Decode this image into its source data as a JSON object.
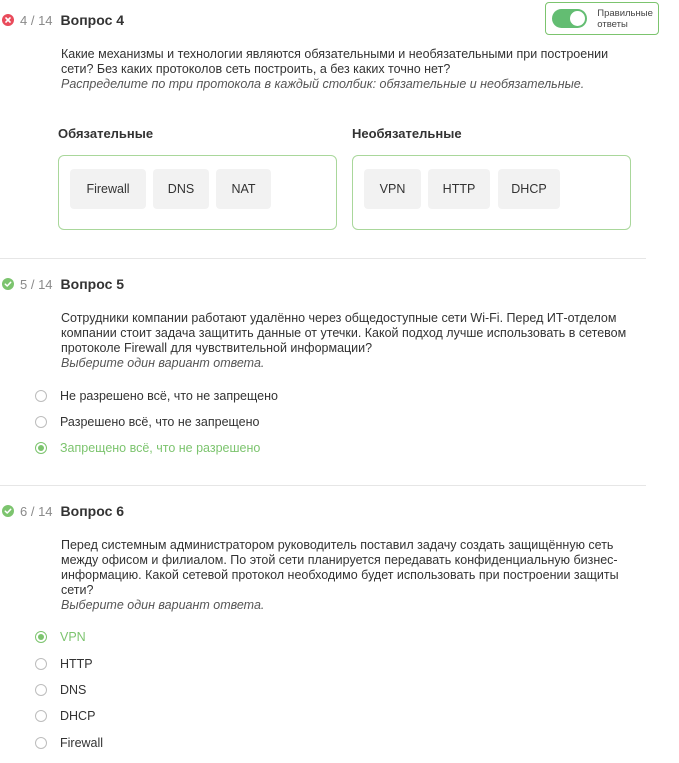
{
  "toggle": {
    "label": "Правильные ответы",
    "on": true
  },
  "q4": {
    "status": "incorrect",
    "counter": "4 / 14",
    "title": "Вопрос 4",
    "text": "Какие механизмы и технологии являются обязательными и необязательными при построении сети? Без каких протоколов сеть построить, а без каких точно нет?",
    "hint": "Распределите по три протокола в каждый столбик: обязательные и необязательные.",
    "col1": {
      "heading": "Обязательные",
      "items": [
        "Firewall",
        "DNS",
        "NAT"
      ]
    },
    "col2": {
      "heading": "Необязательные",
      "items": [
        "VPN",
        "HTTP",
        "DHCP"
      ]
    }
  },
  "q5": {
    "status": "correct",
    "counter": "5 / 14",
    "title": "Вопрос 5",
    "text": "Сотрудники компании работают удалённо через общедоступные сети Wi-Fi. Перед ИТ-отделом компании стоит задача защитить данные от утечки. Какой подход лучше использовать в сетевом протоколе Firewall для чувствительной информации?",
    "hint": "Выберите один вариант ответа.",
    "options": [
      "Не разрешено всё, что не запрещено",
      "Разрешено всё, что не запрещено",
      "Запрещено всё, что не разрешено"
    ],
    "selected": 2
  },
  "q6": {
    "status": "correct",
    "counter": "6 / 14",
    "title": "Вопрос 6",
    "text": "Перед системным администратором руководитель поставил задачу создать защищённую сеть между офисом и филиалом. По этой сети планируется передавать конфиденциальную бизнес-информацию. Какой сетевой протокол необходимо будет использовать при построении защиты сети?",
    "hint": "Выберите один вариант ответа.",
    "options": [
      "VPN",
      "HTTP",
      "DNS",
      "DHCP",
      "Firewall"
    ],
    "selected": 0
  },
  "colors": {
    "accent": "#7cc46e",
    "error": "#e94b5b",
    "muted": "#8a8a8a"
  }
}
